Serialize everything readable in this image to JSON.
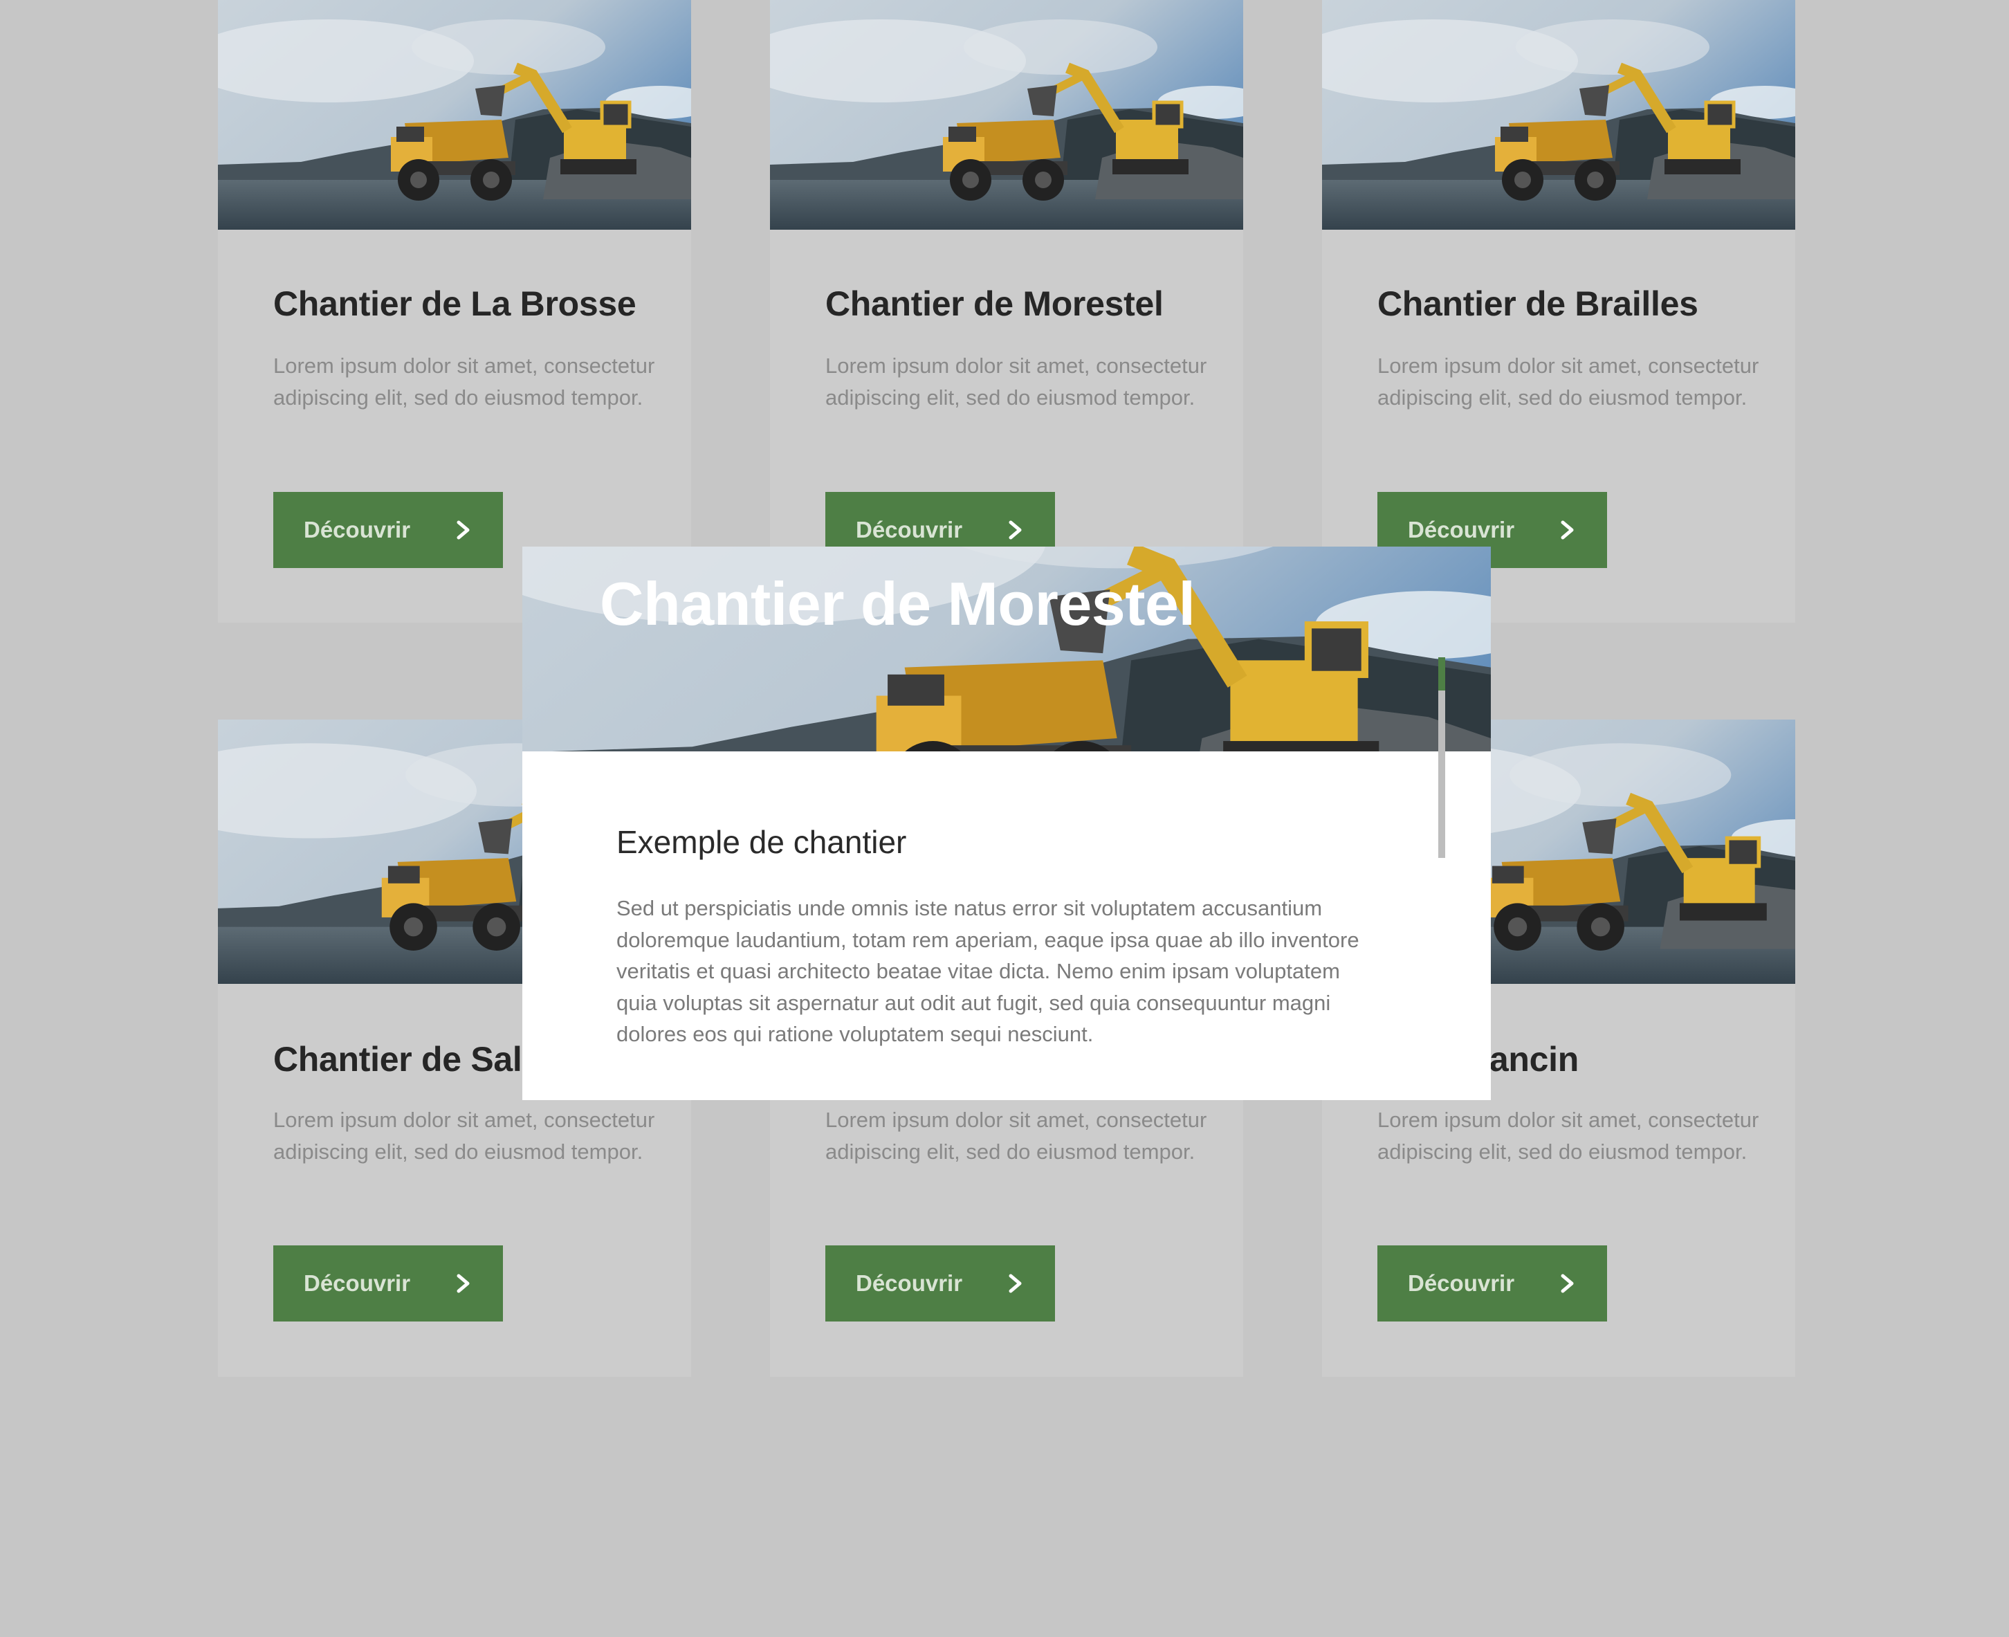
{
  "cards": [
    {
      "title": "Chantier de La Brosse",
      "desc": "Lorem ipsum dolor sit amet, consectetur adipiscing elit, sed do eiusmod tempor.",
      "button": "Découvrir"
    },
    {
      "title": "Chantier de Morestel",
      "desc": "Lorem ipsum dolor sit amet, consectetur adipiscing elit, sed do eiusmod tempor.",
      "button": "Découvrir"
    },
    {
      "title": "Chantier de Brailles",
      "desc": "Lorem ipsum dolor sit amet, consectetur adipiscing elit, sed do eiusmod tempor.",
      "button": "Découvrir"
    },
    {
      "title": "Chantier de Sala",
      "desc": "Lorem ipsum dolor sit amet, consectetur adipiscing elit, sed do eiusmod tempor.",
      "button": "Découvrir"
    },
    {
      "title": "",
      "desc": "Lorem ipsum dolor sit amet, consectetur adipiscing elit, sed do eiusmod tempor.",
      "button": "Découvrir"
    },
    {
      "title": "er de Lancin",
      "desc": "Lorem ipsum dolor sit amet, consectetur adipiscing elit, sed do eiusmod tempor.",
      "button": "Découvrir"
    }
  ],
  "modal": {
    "title": "Chantier de Morestel",
    "subtitle": "Exemple de chantier",
    "body": "Sed ut perspiciatis unde omnis iste natus error sit voluptatem accusantium doloremque laudantium, totam rem aperiam, eaque ipsa quae ab illo inventore veritatis et quasi architecto beatae vitae dicta. Nemo enim ipsam voluptatem quia voluptas sit aspernatur aut odit aut fugit, sed quia consequuntur magni dolores eos qui ratione voluptatem sequi nesciunt."
  },
  "icons": {
    "button": "chevron-right-icon",
    "photo": "mining-excavator-truck-photo"
  },
  "colors": {
    "background": "#c6c6c6",
    "card": "#cccccc",
    "accent": "#4e7f45",
    "modal": "#ffffff"
  }
}
